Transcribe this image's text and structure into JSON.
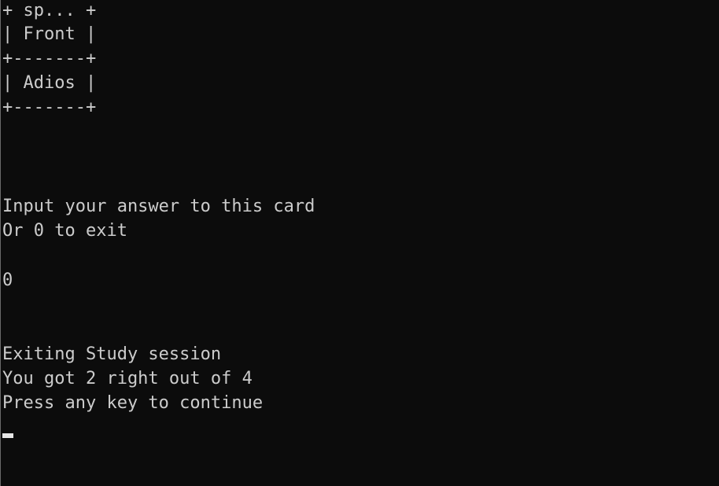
{
  "terminal": {
    "card_table": {
      "header_line": "+ sp... +",
      "front_line": "| Front |",
      "divider_line": "+-------+",
      "answer_line": "| Adios |",
      "bottom_line": "+-------+"
    },
    "prompt_line_1": "Input your answer to this card",
    "prompt_line_2": "Or 0 to exit",
    "user_input": "0",
    "exit_message": "Exiting Study session",
    "score_message": "You got 2 right out of 4",
    "continue_message": "Press any key to continue"
  },
  "colors": {
    "background": "#0c0c0c",
    "text": "#cccccc",
    "cursor": "#e6e6e6"
  },
  "icons": {
    "cursor": "text-cursor-block"
  }
}
